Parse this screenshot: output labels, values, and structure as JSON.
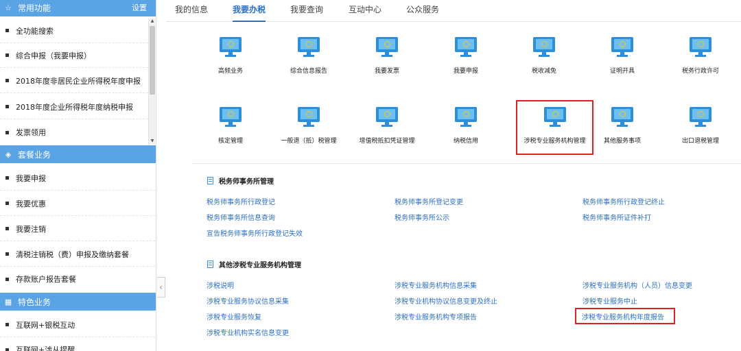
{
  "sidebar": {
    "common": {
      "title": "常用功能",
      "settings": "设置",
      "items": [
        "全功能搜索",
        "综合申报（我要申报）",
        "2018年度非居民企业所得税年度申报",
        "2018年度企业所得税年度纳税申报",
        "发票领用"
      ]
    },
    "package": {
      "title": "套餐业务",
      "items": [
        "我要申报",
        "我要优惠",
        "我要注销",
        "清税注销税（费）申报及缴纳套餐",
        "存款账户报告套餐"
      ]
    },
    "special": {
      "title": "特色业务",
      "items": [
        "互联网+银税互动",
        "互联网+涉从提醒"
      ]
    }
  },
  "tabs": [
    "我的信息",
    "我要办税",
    "我要查询",
    "互动中心",
    "公众服务"
  ],
  "active_tab": "我要办税",
  "tiles": {
    "row1": [
      "高频业务",
      "综合信息报告",
      "我要发票",
      "我要申报",
      "税收减免",
      "证明开具",
      "税务行政许可"
    ],
    "row2": [
      "核定管理",
      "一般退（抵）税管理",
      "增值税抵扣凭证管理",
      "纳税信用",
      "涉税专业服务机构管理",
      "其他服务事项",
      "出口退税管理"
    ]
  },
  "panel": {
    "group1": {
      "title": "税务师事务所管理",
      "links": [
        "税务师事务所行政登记",
        "税务师事务所登记变更",
        "税务师事务所行政登记终止",
        "税务师事务所信息查询",
        "税务师事务所公示",
        "税务师事务所证件补打",
        "宣告税务师事务所行政登记失效"
      ]
    },
    "group2": {
      "title": "其他涉税专业服务机构管理",
      "links": [
        "涉税说明",
        "涉税专业服务机构信息采集",
        "涉税专业服务机构（人员）信息变更",
        "涉税专业服务协议信息采集",
        "涉税专业机构协议信息变更及终止",
        "涉税专业服务中止",
        "涉税专业服务恢复",
        "涉税专业服务机构专项报告",
        "涉税专业服务机构年度报告",
        "涉税专业机构实名信息变更"
      ]
    }
  },
  "colors": {
    "accent": "#2b6fc4",
    "sidebar_header": "#5aa3e4",
    "highlight": "#e02020"
  }
}
